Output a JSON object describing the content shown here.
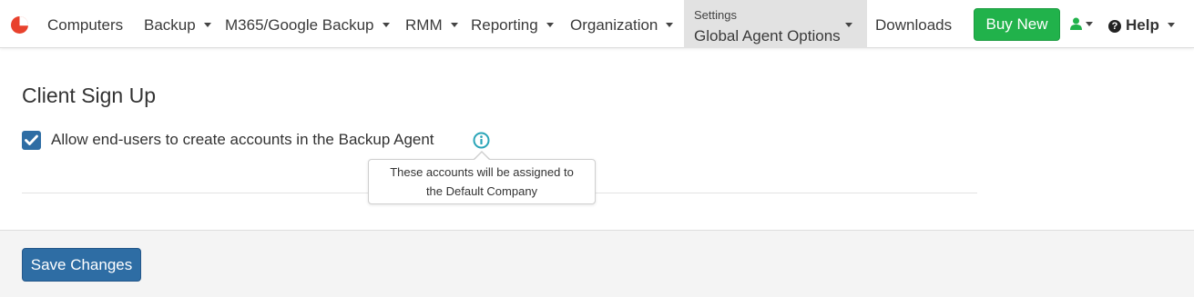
{
  "nav": {
    "items": [
      {
        "label": "Computers",
        "has_caret": false
      },
      {
        "label": "Backup",
        "has_caret": true
      },
      {
        "label": "M365/Google Backup",
        "has_caret": true
      },
      {
        "label": "RMM",
        "has_caret": true
      },
      {
        "label": "Reporting",
        "has_caret": true
      },
      {
        "label": "Organization",
        "has_caret": true
      }
    ],
    "active": {
      "section": "Settings",
      "page": "Global Agent Options"
    },
    "downloads_label": "Downloads",
    "buy_label": "Buy New",
    "help_label": "Help",
    "help_icon_glyph": "?",
    "icons": [
      "logo-icon",
      "user-icon",
      "help-icon"
    ]
  },
  "content": {
    "section_title": "Client Sign Up",
    "checkbox": {
      "label": "Allow end-users to create accounts in the Backup Agent",
      "checked": true
    },
    "tooltip": {
      "line1": "These accounts will be assigned to",
      "line2": "the Default Company"
    }
  },
  "footer": {
    "save_label": "Save Changes"
  },
  "colors": {
    "logo": "#e8412c",
    "buy_button": "#21b24b",
    "primary": "#2e6da4",
    "info_icon": "#2aa5b8",
    "user_icon": "#21b24b",
    "accent_orange": "#f07f3c"
  }
}
